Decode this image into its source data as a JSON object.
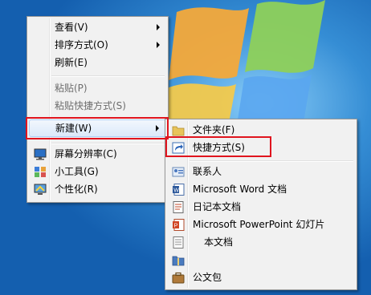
{
  "desktop_menu": {
    "items": [
      {
        "label": "查看(V)",
        "has_submenu": true
      },
      {
        "label": "排序方式(O)",
        "has_submenu": true
      },
      {
        "label": "刷新(E)"
      },
      {
        "label": "粘贴(P)",
        "disabled": true
      },
      {
        "label": "粘贴快捷方式(S)",
        "disabled": true
      },
      {
        "label": "新建(W)",
        "has_submenu": true,
        "highlighted": true
      },
      {
        "label": "屏幕分辨率(C)",
        "icon": "monitor-icon"
      },
      {
        "label": "小工具(G)",
        "icon": "gadgets-icon"
      },
      {
        "label": "个性化(R)",
        "icon": "personalize-icon"
      }
    ]
  },
  "new_submenu": {
    "items": [
      {
        "label": "文件夹(F)",
        "icon": "folder-icon"
      },
      {
        "label": "快捷方式(S)",
        "icon": "shortcut-icon",
        "highlighted": true
      },
      {
        "label": "联系人",
        "icon": "contact-icon"
      },
      {
        "label": "Microsoft Word 文档",
        "icon": "word-doc-icon"
      },
      {
        "label": "日记本文档",
        "icon": "journal-icon"
      },
      {
        "label": "Microsoft PowerPoint 幻灯片",
        "icon": "powerpoint-icon"
      },
      {
        "label": "本文档",
        "icon": "text-doc-icon"
      },
      {
        "label": "公文包",
        "icon": "briefcase-icon"
      }
    ]
  },
  "colors": {
    "highlight_box": "#e0141e",
    "desktop_blue": "#1a6cb8",
    "menu_bg": "#f1f1f1"
  }
}
